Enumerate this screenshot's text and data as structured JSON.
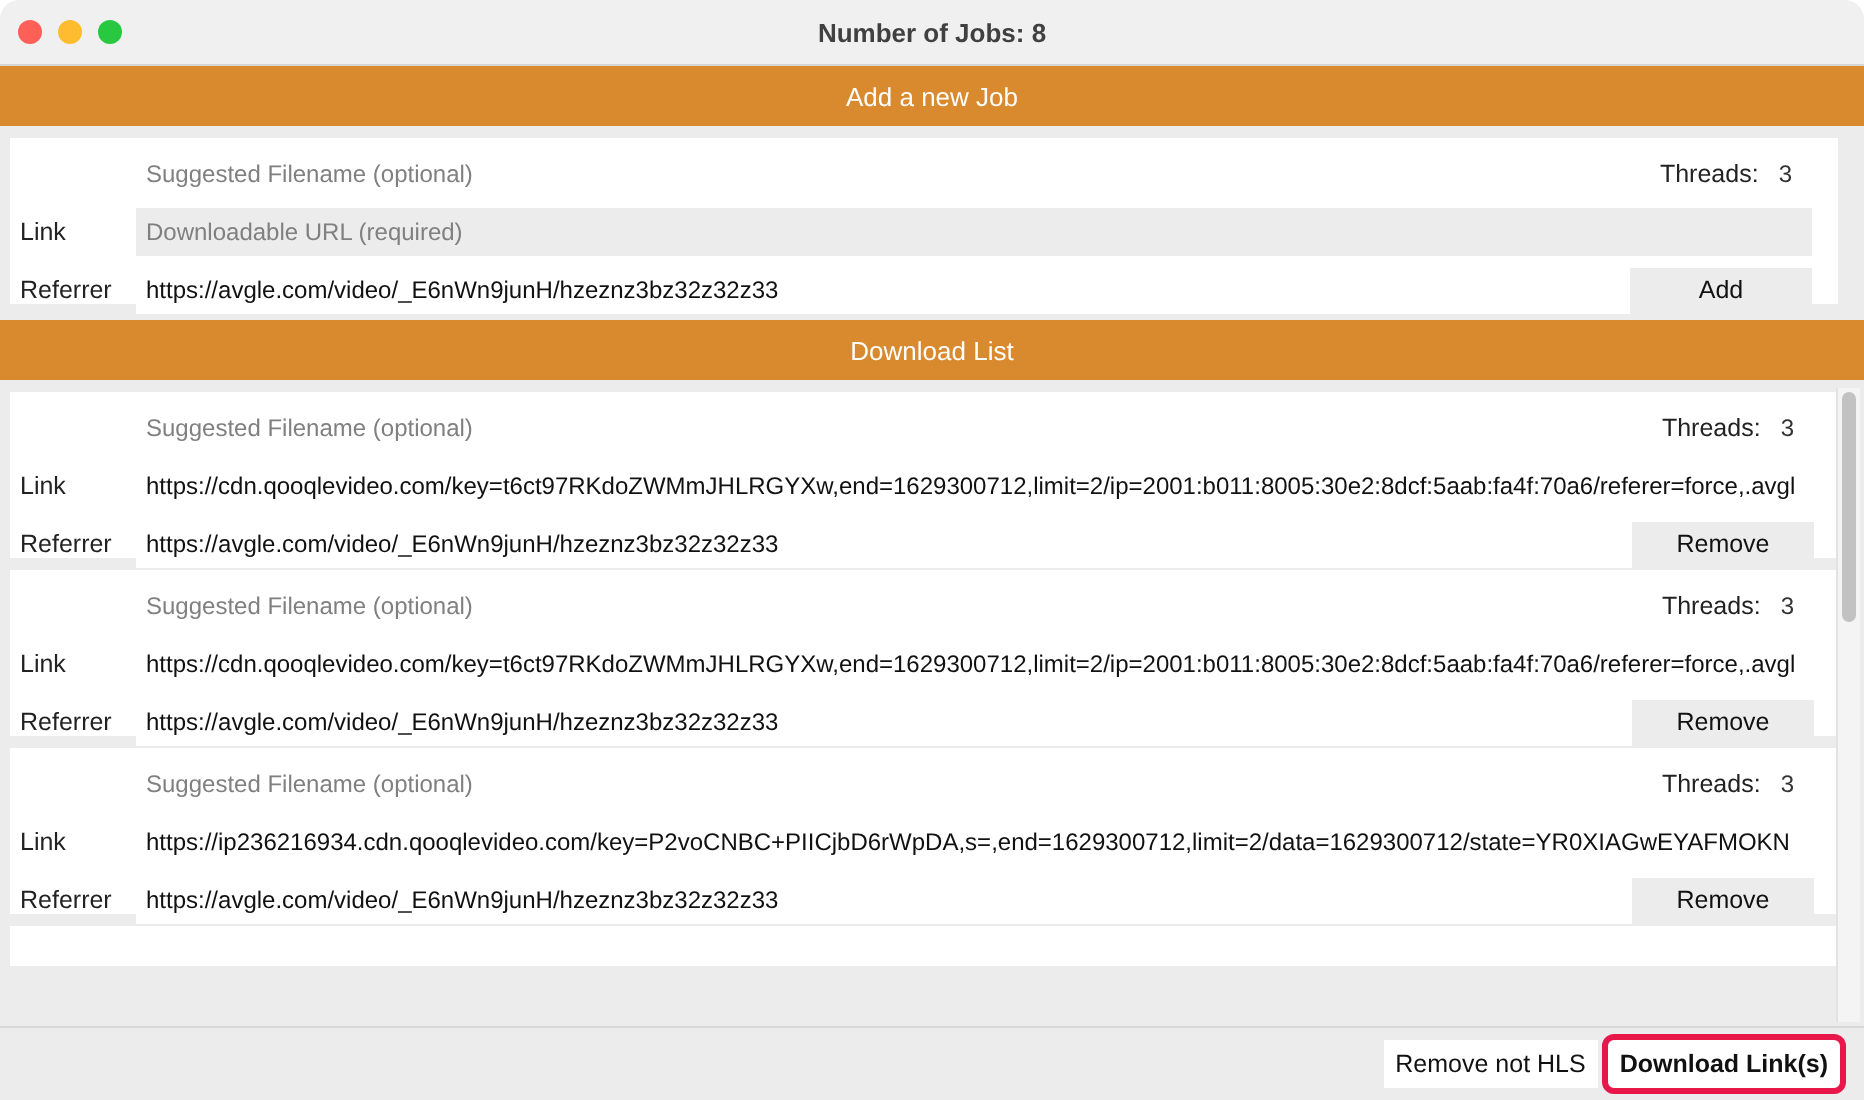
{
  "window": {
    "title": "Number of Jobs: 8"
  },
  "new_job": {
    "header": "Add a new Job",
    "filename_placeholder": "Suggested Filename (optional)",
    "threads_label": "Threads:",
    "threads": "3",
    "link_label": "Link",
    "link_placeholder": "Downloadable URL (required)",
    "referrer_label": "Referrer",
    "referrer": "https://avgle.com/video/_E6nWn9junH/hzeznz3bz32z32z33",
    "add_button": "Add"
  },
  "download_list": {
    "header": "Download List",
    "jobs": [
      {
        "filename_placeholder": "Suggested Filename (optional)",
        "threads_label": "Threads:",
        "threads": "3",
        "link_label": "Link",
        "link": "https://cdn.qooqlevideo.com/key=t6ct97RKdoZWMmJHLRGYXw,end=1629300712,limit=2/ip=2001:b011:8005:30e2:8dcf:5aab:fa4f:70a6/referer=force,.avgl",
        "referrer_label": "Referrer",
        "referrer": "https://avgle.com/video/_E6nWn9junH/hzeznz3bz32z32z33",
        "remove_button": "Remove"
      },
      {
        "filename_placeholder": "Suggested Filename (optional)",
        "threads_label": "Threads:",
        "threads": "3",
        "link_label": "Link",
        "link": "https://cdn.qooqlevideo.com/key=t6ct97RKdoZWMmJHLRGYXw,end=1629300712,limit=2/ip=2001:b011:8005:30e2:8dcf:5aab:fa4f:70a6/referer=force,.avgl",
        "referrer_label": "Referrer",
        "referrer": "https://avgle.com/video/_E6nWn9junH/hzeznz3bz32z32z33",
        "remove_button": "Remove"
      },
      {
        "filename_placeholder": "Suggested Filename (optional)",
        "threads_label": "Threads:",
        "threads": "3",
        "link_label": "Link",
        "link": "https://ip236216934.cdn.qooqlevideo.com/key=P2voCNBC+PIICjbD6rWpDA,s=,end=1629300712,limit=2/data=1629300712/state=YR0XIAGwEYAFMOKN",
        "referrer_label": "Referrer",
        "referrer": "https://avgle.com/video/_E6nWn9junH/hzeznz3bz32z32z33",
        "remove_button": "Remove"
      }
    ]
  },
  "footer": {
    "buttons": [
      {
        "label": "Remove not HLS",
        "highlighted": false
      },
      {
        "label": "Download Link(s)",
        "highlighted": true
      }
    ]
  }
}
